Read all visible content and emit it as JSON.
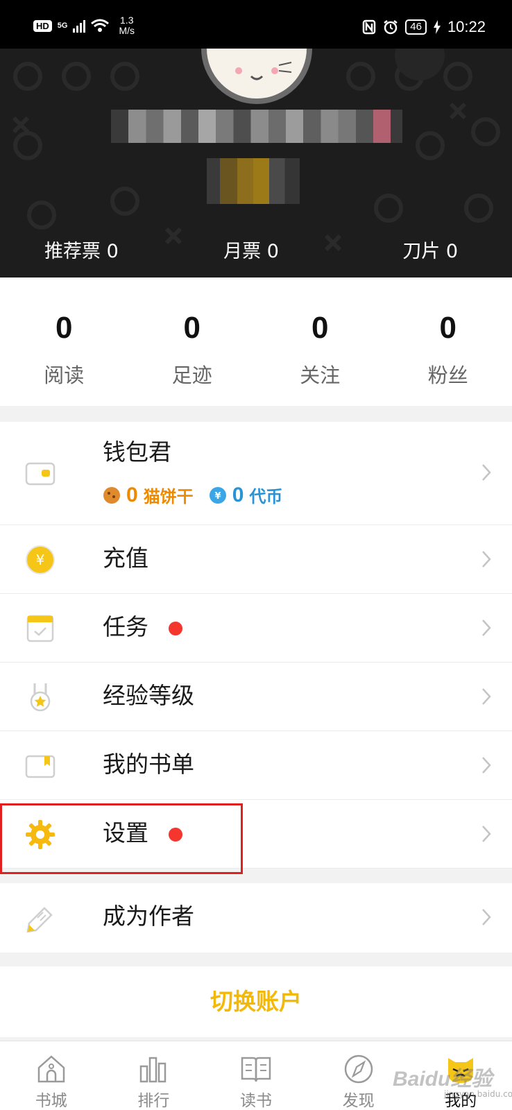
{
  "status_bar": {
    "hd": "HD",
    "network": "5G",
    "speed_value": "1.3",
    "speed_unit": "M/s",
    "battery": "46",
    "time": "10:22"
  },
  "profile": {
    "stats": [
      {
        "label": "推荐票",
        "value": "0"
      },
      {
        "label": "月票",
        "value": "0"
      },
      {
        "label": "刀片",
        "value": "0"
      }
    ]
  },
  "counts": [
    {
      "value": "0",
      "label": "阅读"
    },
    {
      "value": "0",
      "label": "足迹"
    },
    {
      "value": "0",
      "label": "关注"
    },
    {
      "value": "0",
      "label": "粉丝"
    }
  ],
  "wallet": {
    "title": "钱包君",
    "coin1_value": "0",
    "coin1_label": "猫饼干",
    "coin2_value": "0",
    "coin2_label": "代币"
  },
  "menu": [
    {
      "label": "充值",
      "icon": "recharge-yen-icon"
    },
    {
      "label": "任务",
      "icon": "task-calendar-icon",
      "badge": true
    },
    {
      "label": "经验等级",
      "icon": "level-medal-icon"
    },
    {
      "label": "我的书单",
      "icon": "booklist-icon"
    },
    {
      "label": "设置",
      "icon": "gear-icon",
      "badge": true
    }
  ],
  "author": {
    "label": "成为作者",
    "icon": "pen-icon"
  },
  "switch_account": "切换账户",
  "nav": [
    {
      "label": "书城",
      "icon": "bookstore-icon"
    },
    {
      "label": "排行",
      "icon": "ranking-icon"
    },
    {
      "label": "读书",
      "icon": "book-icon"
    },
    {
      "label": "发现",
      "icon": "compass-icon"
    },
    {
      "label": "我的",
      "icon": "cat-avatar-icon",
      "active": true
    }
  ],
  "watermark": {
    "brand": "Baidu经验",
    "url": "jingyan.baidu.com"
  },
  "colors": {
    "accent": "#f2b80a",
    "badge": "#f5362f",
    "highlight": "#e11f1f",
    "coin_orange": "#ee8a00",
    "coin_blue": "#2a93d6"
  }
}
